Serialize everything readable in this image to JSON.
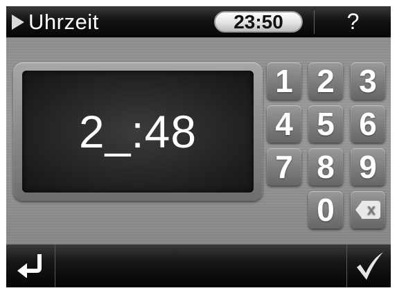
{
  "header": {
    "title": "Uhrzeit",
    "title_icon": "play-icon",
    "clock": "23:50",
    "help_label": "?"
  },
  "display": {
    "value": "2_:48"
  },
  "keypad": {
    "keys": [
      "1",
      "2",
      "3",
      "4",
      "5",
      "6",
      "7",
      "8",
      "9",
      "0"
    ],
    "backspace_icon": "backspace-icon",
    "backspace_glyph": "x"
  },
  "footer": {
    "enter_icon": "enter-arrow-icon",
    "ok_icon": "checkmark-icon"
  },
  "colors": {
    "bar": "#0a0a0a",
    "panel": "#8f8f8f",
    "key": "#7c7c7c",
    "text": "#ffffff"
  }
}
